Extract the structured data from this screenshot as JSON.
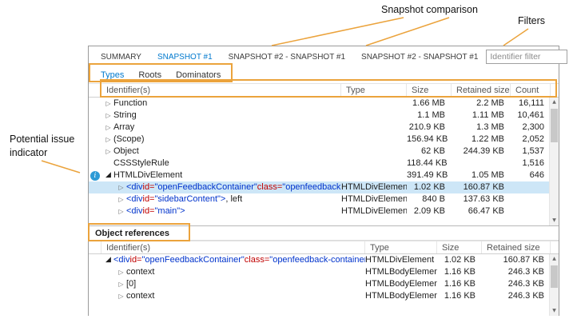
{
  "colors": {
    "accent": "#0079ce",
    "selection_bg": "#cde6f7",
    "callout": "#EBA33C",
    "syntax_tag": "#0033cc",
    "syntax_attr": "#c00000",
    "info_icon": "#2e9bd6"
  },
  "callouts": {
    "snapshot_comparison": "Snapshot comparison",
    "filters": "Filters",
    "potential_issue_line1": "Potential issue",
    "potential_issue_line2": "indicator"
  },
  "tabs": [
    {
      "label": "SUMMARY",
      "active": false
    },
    {
      "label": "SNAPSHOT #1",
      "active": true
    },
    {
      "label": "SNAPSHOT #2 - SNAPSHOT #1",
      "active": false
    },
    {
      "label": "SNAPSHOT #2 - SNAPSHOT #1",
      "active": false
    }
  ],
  "toolbar": {
    "filter_placeholder": "Identifier filter"
  },
  "view_tabs": [
    {
      "label": "Types",
      "active": true
    },
    {
      "label": "Roots",
      "active": false
    },
    {
      "label": "Dominators",
      "active": false
    }
  ],
  "icons": {
    "expand": "▷",
    "collapse": "◢",
    "scroll_up": "▲",
    "scroll_down": "▼",
    "grid_view": "▦",
    "dropdown": "▾",
    "info": "i",
    "filter": "funnel-lines"
  },
  "types_grid": {
    "columns": [
      "Identifier(s)",
      "Type",
      "Size",
      "Retained size",
      "Count"
    ],
    "rows": [
      {
        "expander": "collapsed",
        "indent": 0,
        "identifier": [
          {
            "t": "Function",
            "c": "plain"
          }
        ],
        "type": "",
        "size": "1.66 MB",
        "retained": "2.2 MB",
        "count": "16,111",
        "selected": false,
        "issue": false
      },
      {
        "expander": "collapsed",
        "indent": 0,
        "identifier": [
          {
            "t": "String",
            "c": "plain"
          }
        ],
        "type": "",
        "size": "1.1 MB",
        "retained": "1.11 MB",
        "count": "10,461",
        "selected": false,
        "issue": false
      },
      {
        "expander": "collapsed",
        "indent": 0,
        "identifier": [
          {
            "t": "Array",
            "c": "plain"
          }
        ],
        "type": "",
        "size": "210.9 KB",
        "retained": "1.3 MB",
        "count": "2,300",
        "selected": false,
        "issue": false
      },
      {
        "expander": "collapsed",
        "indent": 0,
        "identifier": [
          {
            "t": "(Scope)",
            "c": "plain"
          }
        ],
        "type": "",
        "size": "156.94 KB",
        "retained": "1.22 MB",
        "count": "2,052",
        "selected": false,
        "issue": false
      },
      {
        "expander": "collapsed",
        "indent": 0,
        "identifier": [
          {
            "t": "Object",
            "c": "plain"
          }
        ],
        "type": "",
        "size": "62 KB",
        "retained": "244.39 KB",
        "count": "1,537",
        "selected": false,
        "issue": false
      },
      {
        "expander": "none",
        "indent": 0,
        "identifier": [
          {
            "t": "CSSStyleRule",
            "c": "plain"
          }
        ],
        "type": "",
        "size": "118.44 KB",
        "retained": "",
        "count": "1,516",
        "selected": false,
        "issue": false
      },
      {
        "expander": "expanded",
        "indent": 0,
        "identifier": [
          {
            "t": "HTMLDivElement",
            "c": "plain"
          }
        ],
        "type": "",
        "size": "391.49 KB",
        "retained": "1.05 MB",
        "count": "646",
        "selected": false,
        "issue": true
      },
      {
        "expander": "collapsed",
        "indent": 1,
        "identifier": [
          {
            "t": "<div ",
            "c": "tag"
          },
          {
            "t": "id=",
            "c": "attr"
          },
          {
            "t": "\"openFeedbackContainer\" ",
            "c": "tag"
          },
          {
            "t": "class=",
            "c": "attr"
          },
          {
            "t": "\"openfeedback-co...",
            "c": "tag"
          }
        ],
        "type": "HTMLDivElement",
        "size": "1.02 KB",
        "retained": "160.87 KB",
        "count": "",
        "selected": true,
        "issue": false
      },
      {
        "expander": "collapsed",
        "indent": 1,
        "identifier": [
          {
            "t": "<div ",
            "c": "tag"
          },
          {
            "t": "id=",
            "c": "attr"
          },
          {
            "t": "\"sidebarContent\">",
            "c": "tag"
          },
          {
            "t": ", left",
            "c": "plain"
          }
        ],
        "type": "HTMLDivElement",
        "size": "840 B",
        "retained": "137.63 KB",
        "count": "",
        "selected": false,
        "issue": false
      },
      {
        "expander": "collapsed",
        "indent": 1,
        "identifier": [
          {
            "t": "<div ",
            "c": "tag"
          },
          {
            "t": "id=",
            "c": "attr"
          },
          {
            "t": "\"main\">",
            "c": "tag"
          }
        ],
        "type": "HTMLDivElement",
        "size": "2.09 KB",
        "retained": "66.47 KB",
        "count": "",
        "selected": false,
        "issue": false
      }
    ]
  },
  "references_panel": {
    "title": "Object references",
    "columns": [
      "Identifier(s)",
      "Type",
      "Size",
      "Retained size"
    ],
    "rows": [
      {
        "expander": "expanded",
        "indent": 0,
        "identifier": [
          {
            "t": "<div ",
            "c": "tag"
          },
          {
            "t": "id=",
            "c": "attr"
          },
          {
            "t": "\"openFeedbackContainer\" ",
            "c": "tag"
          },
          {
            "t": "class=",
            "c": "attr"
          },
          {
            "t": "\"openfeedback-container foote...",
            "c": "tag"
          }
        ],
        "type": "HTMLDivElement",
        "size": "1.02 KB",
        "retained": "160.87 KB",
        "selected": false,
        "issue": false
      },
      {
        "expander": "collapsed",
        "indent": 1,
        "identifier": [
          {
            "t": "context",
            "c": "plain"
          }
        ],
        "type": "HTMLBodyElement",
        "size": "1.16 KB",
        "retained": "246.3 KB",
        "selected": false,
        "issue": false
      },
      {
        "expander": "collapsed",
        "indent": 1,
        "identifier": [
          {
            "t": "[0]",
            "c": "plain"
          }
        ],
        "type": "HTMLBodyElement",
        "size": "1.16 KB",
        "retained": "246.3 KB",
        "selected": false,
        "issue": false
      },
      {
        "expander": "collapsed",
        "indent": 1,
        "identifier": [
          {
            "t": "context",
            "c": "plain"
          }
        ],
        "type": "HTMLBodyElement",
        "size": "1.16 KB",
        "retained": "246.3 KB",
        "selected": false,
        "issue": false
      }
    ]
  }
}
